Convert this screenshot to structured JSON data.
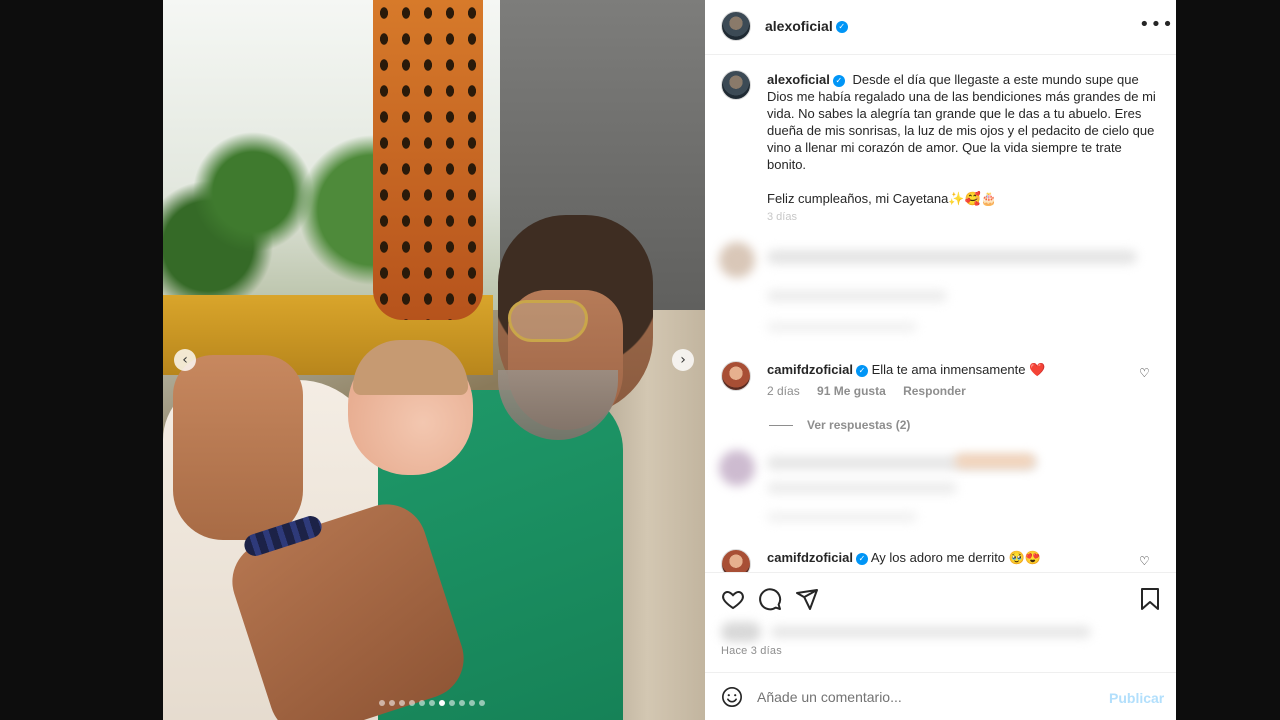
{
  "post": {
    "username": "alexoficial",
    "verified": true,
    "more_icon": "more-options-icon"
  },
  "caption": {
    "username": "alexoficial",
    "text": "Desde el día que llegaste a este mundo supe que Dios me había regalado una de las bendiciones más grandes de mi vida. No sabes la alegría tan grande que le das a tu abuelo. Eres dueña de mis sonrisas, la luz de mis ojos y el pedacito de cielo que vino a llenar mi corazón de amor. Que la vida siempre te trate bonito.",
    "text2": "Feliz cumpleaños, mi Cayetana✨🥰🎂",
    "time": "3 días"
  },
  "comments": [
    {
      "username": "camifdzoficial",
      "verified": true,
      "text": "Ella te ama inmensamente ❤️",
      "time": "2 días",
      "likes": "91 Me gusta",
      "reply": "Responder",
      "view_replies": "Ver respuestas (2)"
    },
    {
      "username": "camifdzoficial",
      "verified": true,
      "text": "Ay los adoro me derrito 🥹😍"
    }
  ],
  "footer": {
    "time": "Hace 3 días"
  },
  "composer": {
    "placeholder": "Añade un comentario...",
    "publish": "Publicar"
  },
  "carousel": {
    "count": 11,
    "active_index": 6
  },
  "colors": {
    "accent": "#0095f6",
    "publish_disabled": "#b2dffc",
    "secondary_text": "#8e8e8e"
  }
}
